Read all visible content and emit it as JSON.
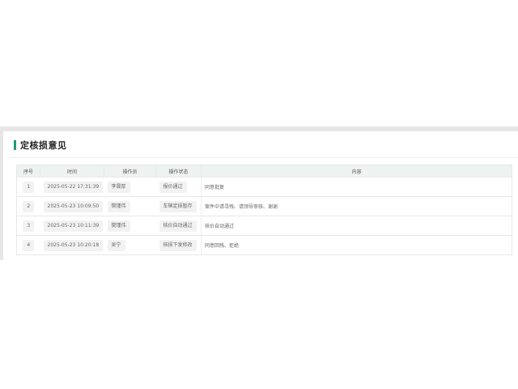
{
  "panel": {
    "title": "定核损意见"
  },
  "table": {
    "headers": {
      "index": "序号",
      "time": "时间",
      "operator": "操作员",
      "status": "操作状态",
      "content": "内容"
    },
    "rows": [
      {
        "index": "1",
        "time": "2025-05-22 17:31:39",
        "operator": "李晟厚",
        "status": "报价通过",
        "content": "同意批复"
      },
      {
        "index": "2",
        "time": "2025-05-23 10:09:50",
        "operator": "樊瑾伟",
        "status": "车辆定损暂存",
        "content": "案件中请寻残、请领导审核、谢谢"
      },
      {
        "index": "3",
        "time": "2025-05-23 10:11:39",
        "operator": "樊瑾伟",
        "status": "核价自动通过",
        "content": "核价自动通过"
      },
      {
        "index": "4",
        "time": "2025-05-23 10:20:18",
        "operator": "吴宁",
        "status": "核损下发修改",
        "content": "同意回残、拒绝"
      }
    ]
  },
  "colors": {
    "accent": "#1e9c6a",
    "header_bg": "#eef3f2",
    "outer_bg": "#e6e6e6"
  }
}
